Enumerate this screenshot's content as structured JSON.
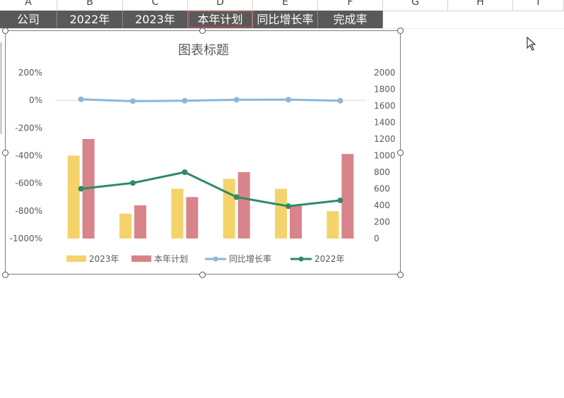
{
  "column_headers": [
    "A",
    "B",
    "C",
    "D",
    "E",
    "F",
    "G",
    "H",
    "I"
  ],
  "header_row": [
    "公司",
    "2022年",
    "2023年",
    "本年计划",
    "同比增长率",
    "完成率"
  ],
  "chart_data": {
    "type": "bar",
    "title": "图表标题",
    "categories": [
      "",
      "",
      "",
      "",
      "",
      ""
    ],
    "series": [
      {
        "name": "2023年",
        "kind": "bar",
        "axis": "right",
        "color": "#f4d36b",
        "values": [
          1000,
          300,
          600,
          720,
          600,
          330
        ]
      },
      {
        "name": "本年计划",
        "kind": "bar",
        "axis": "right",
        "color": "#d9838a",
        "values": [
          1200,
          400,
          500,
          800,
          400,
          1020
        ]
      },
      {
        "name": "同比增长率",
        "kind": "line",
        "axis": "left",
        "color": "#8ab6dc",
        "values": [
          0.07,
          -0.06,
          -0.03,
          0.04,
          0.05,
          -0.03
        ]
      },
      {
        "name": "2022年",
        "kind": "line",
        "axis": "right",
        "color": "#2e8b63",
        "values": [
          600,
          670,
          800,
          500,
          390,
          460
        ]
      }
    ],
    "y_left": {
      "min": -10,
      "max": 2,
      "ticks": [
        "200%",
        "0%",
        "-200%",
        "-400%",
        "-600%",
        "-800%",
        "-1000%"
      ]
    },
    "y_right": {
      "min": 0,
      "max": 2000,
      "ticks": [
        "2000",
        "1800",
        "1600",
        "1400",
        "1200",
        "1000",
        "800",
        "600",
        "400",
        "200",
        "0"
      ]
    },
    "legend_position": "bottom",
    "grid": "zero-line only"
  }
}
